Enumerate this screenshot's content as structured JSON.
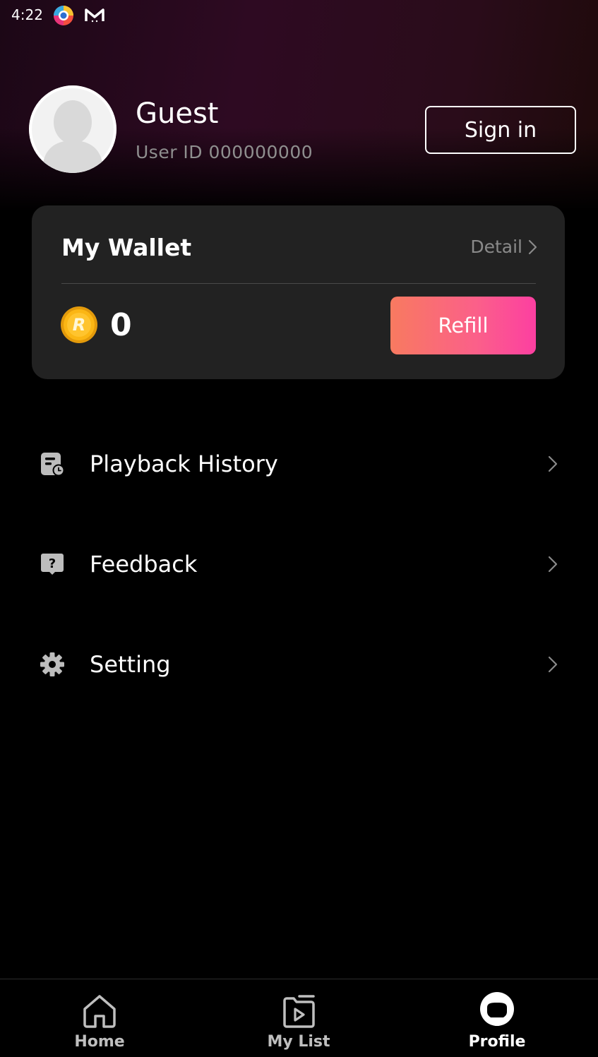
{
  "status_bar": {
    "time": "4:22"
  },
  "profile": {
    "name": "Guest",
    "user_id": "User ID 000000000",
    "sign_in_label": "Sign in"
  },
  "wallet": {
    "title": "My Wallet",
    "detail_label": "Detail",
    "balance": "0",
    "refill_label": "Refill"
  },
  "menu": {
    "items": [
      {
        "label": "Playback History",
        "icon": "playback-history-icon"
      },
      {
        "label": "Feedback",
        "icon": "feedback-icon"
      },
      {
        "label": "Setting",
        "icon": "gear-icon"
      }
    ]
  },
  "bottom_nav": {
    "items": [
      {
        "label": "Home",
        "icon": "home-icon",
        "active": false
      },
      {
        "label": "My List",
        "icon": "my-list-icon",
        "active": false
      },
      {
        "label": "Profile",
        "icon": "profile-icon",
        "active": true
      }
    ]
  },
  "colors": {
    "background": "#000000",
    "card": "#222222",
    "refill_gradient_start": "#f87a60",
    "refill_gradient_end": "#fc3fa1",
    "muted_text": "#8f8f8f",
    "inactive_nav": "#bfbfbf"
  }
}
